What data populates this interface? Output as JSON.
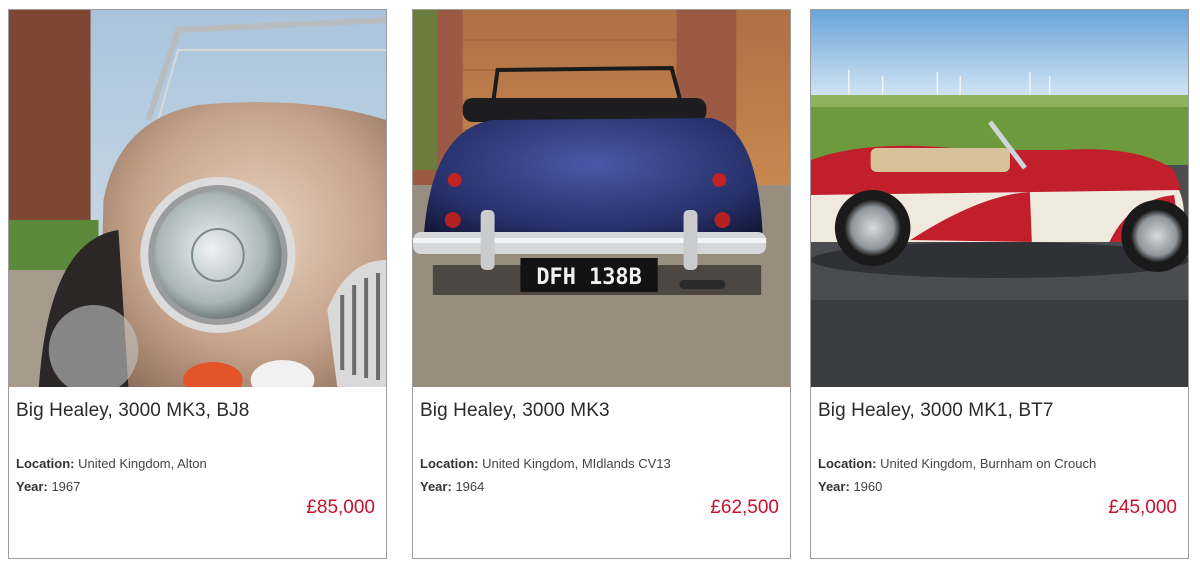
{
  "listings": [
    {
      "title": "Big Healey, 3000 MK3, BJ8",
      "location_label": "Location:",
      "location": "United Kingdom, Alton",
      "year_label": "Year:",
      "year": "1967",
      "price": "£85,000"
    },
    {
      "title": "Big Healey, 3000 MK3",
      "location_label": "Location:",
      "location": "United Kingdom, MIdlands CV13",
      "year_label": "Year:",
      "year": "1964",
      "price": "£62,500",
      "plate": "DFH 138B"
    },
    {
      "title": "Big Healey, 3000 MK1, BT7",
      "location_label": "Location:",
      "location": "United Kingdom, Burnham on Crouch",
      "year_label": "Year:",
      "year": "1960",
      "price": "£45,000"
    }
  ],
  "colors": {
    "price": "#c8102e",
    "border": "#9c9c9c",
    "car1": "#c9a98f",
    "car2": "#27306a",
    "car3": "#c21f2c"
  }
}
